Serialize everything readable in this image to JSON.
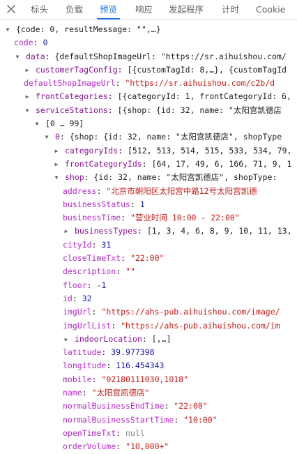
{
  "tabs": [
    {
      "label": "标头",
      "active": false
    },
    {
      "label": "负载",
      "active": false
    },
    {
      "label": "预览",
      "active": true
    },
    {
      "label": "响应",
      "active": false
    },
    {
      "label": "发起程序",
      "active": false
    },
    {
      "label": "计时",
      "active": false
    },
    {
      "label": "Cookie",
      "active": false
    }
  ],
  "accent_color": "#1a73e8",
  "close_icon": "close-icon",
  "tree": [
    {
      "indent": 6,
      "arrow": "down",
      "preview": "{code: 0, resultMessage: \"\",…}"
    },
    {
      "indent": 20,
      "key": "code",
      "value": "0",
      "type": "number"
    },
    {
      "indent": 20,
      "arrow": "down",
      "key": "data",
      "preview": "{defaultShopImageUrl: \"https://sr.aihuishou.com/"
    },
    {
      "indent": 34,
      "arrow": "right",
      "key": "customerTagConfig",
      "preview": "[{customTagId: 8,…}, {customTagId"
    },
    {
      "indent": 34,
      "key": "defaultShopImageUrl",
      "value": "\"https://sr.aihuishou.com/c2b/d",
      "type": "string"
    },
    {
      "indent": 34,
      "arrow": "right",
      "key": "frontCategories",
      "preview": "[{categoryId: 1, frontCategoryId: 6,"
    },
    {
      "indent": 34,
      "arrow": "down",
      "key": "serviceStations",
      "preview": "[{shop: {id: 32, name: \"太阳宫凯德店"
    },
    {
      "indent": 48,
      "arrow": "down",
      "range": "[0 … 99]"
    },
    {
      "indent": 62,
      "arrow": "down",
      "key": "0",
      "preview": "{shop: {id: 32, name: \"太阳宫凯德店\", shopType"
    },
    {
      "indent": 76,
      "arrow": "right",
      "key": "categoryIds",
      "preview": "[512, 513, 514, 515, 533, 534, 79,"
    },
    {
      "indent": 76,
      "arrow": "right",
      "key": "frontCategoryIds",
      "preview": "[64, 17, 49, 6, 166, 71, 9, 1"
    },
    {
      "indent": 76,
      "arrow": "down",
      "key": "shop",
      "preview": "{id: 32, name: \"太阳宫凯德店\", shopType: "
    },
    {
      "indent": 90,
      "key": "address",
      "value": "\"北京市朝阳区太阳宫中路12号太阳宫凯德",
      "type": "string"
    },
    {
      "indent": 90,
      "key": "businessStatus",
      "value": "1",
      "type": "number"
    },
    {
      "indent": 90,
      "key": "businessTime",
      "value": "\"营业时间 10:00 - 22:00\"",
      "type": "string"
    },
    {
      "indent": 90,
      "arrow": "right",
      "key": "businessTypes",
      "preview": "[1, 3, 4, 6, 8, 9, 10, 11, 13,"
    },
    {
      "indent": 90,
      "key": "cityId",
      "value": "31",
      "type": "number"
    },
    {
      "indent": 90,
      "key": "closeTimeTxt",
      "value": "\"22:00\"",
      "type": "string"
    },
    {
      "indent": 90,
      "key": "description",
      "value": "\"\"",
      "type": "string"
    },
    {
      "indent": 90,
      "key": "floor",
      "value": "-1",
      "type": "number"
    },
    {
      "indent": 90,
      "key": "id",
      "value": "32",
      "type": "number"
    },
    {
      "indent": 90,
      "key": "imgUrl",
      "value": "\"https://ahs-pub.aihuishou.com/image/",
      "type": "string"
    },
    {
      "indent": 90,
      "key": "imgUrlList",
      "value": "\"https://ahs-pub.aihuishou.com/im",
      "type": "string"
    },
    {
      "indent": 90,
      "arrow": "right",
      "key": "indoorLocation",
      "preview": "[,…]"
    },
    {
      "indent": 90,
      "key": "latitude",
      "value": "39.977398",
      "type": "number"
    },
    {
      "indent": 90,
      "key": "longitude",
      "value": "116.454343",
      "type": "number"
    },
    {
      "indent": 90,
      "key": "mobile",
      "value": "\"02180111030,1018\"",
      "type": "string"
    },
    {
      "indent": 90,
      "key": "name",
      "value": "\"太阳宫凯德店\"",
      "type": "string"
    },
    {
      "indent": 90,
      "key": "normalBusinessEndTime",
      "value": "\"22:00\"",
      "type": "string"
    },
    {
      "indent": 90,
      "key": "normalBusinessStartTime",
      "value": "\"10:00\"",
      "type": "string"
    },
    {
      "indent": 90,
      "key": "openTimeTxt",
      "value": "null",
      "type": "null"
    },
    {
      "indent": 90,
      "key": "orderVolume",
      "value": "\"10,000+\"",
      "type": "string"
    }
  ]
}
